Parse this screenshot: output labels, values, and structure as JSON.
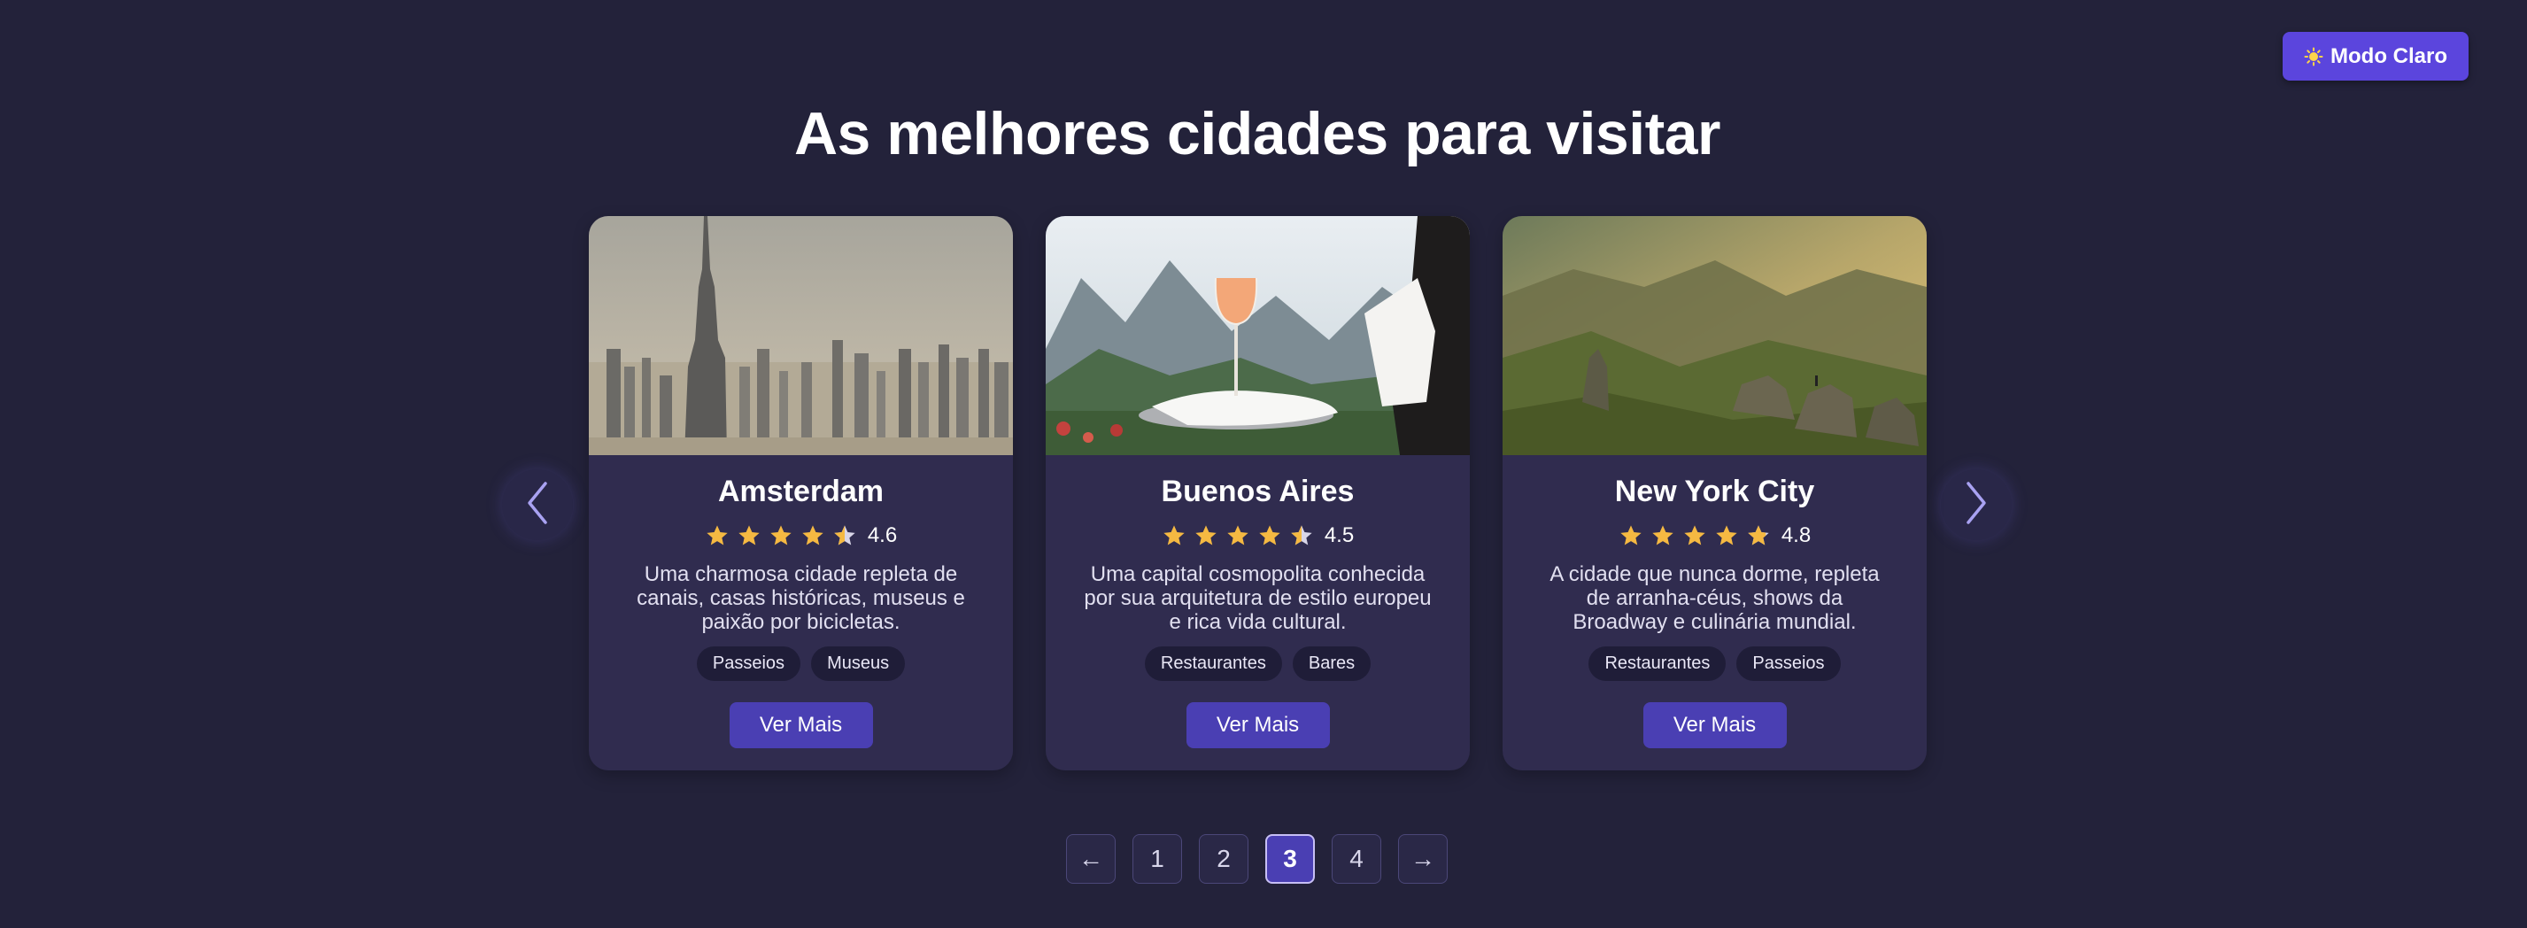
{
  "header": {
    "theme_toggle_label": "Modo Claro",
    "theme_toggle_icon": "sun-icon"
  },
  "main": {
    "title": "As melhores cidades para visitar",
    "carousel": {
      "prev_icon": "chevron-left-icon",
      "next_icon": "chevron-right-icon",
      "cards": [
        {
          "name": "Amsterdam",
          "rating": "4.6",
          "rating_value": 4.6,
          "description": "Uma charmosa cidade repleta de canais, casas históricas, museus e paixão por bicicletas.",
          "tags": [
            "Passeios",
            "Museus"
          ],
          "button_label": "Ver Mais",
          "image": "city skyline with skyscrapers"
        },
        {
          "name": "Buenos Aires",
          "rating": "4.5",
          "rating_value": 4.5,
          "description": "Uma capital cosmopolita conhecida por sua arquitetura de estilo europeu e rica vida cultural.",
          "tags": [
            "Restaurantes",
            "Bares"
          ],
          "button_label": "Ver Mais",
          "image": "waiter holding wine glass on tray with mountains"
        },
        {
          "name": "New York City",
          "rating": "4.8",
          "rating_value": 4.8,
          "description": "A cidade que nunca dorme, repleta de arranha-céus, shows da Broadway e culinária mundial.",
          "tags": [
            "Restaurantes",
            "Passeios"
          ],
          "button_label": "Ver Mais",
          "image": "mountain landscape at sunset with rocks"
        }
      ]
    }
  },
  "pagination": {
    "prev": "←",
    "next": "→",
    "pages": [
      "1",
      "2",
      "3",
      "4"
    ],
    "current": "3"
  },
  "colors": {
    "background": "#23223a",
    "card": "#302c4f",
    "accent": "#5b45dd",
    "button": "#4a3fb3",
    "star": "#f5b942"
  }
}
